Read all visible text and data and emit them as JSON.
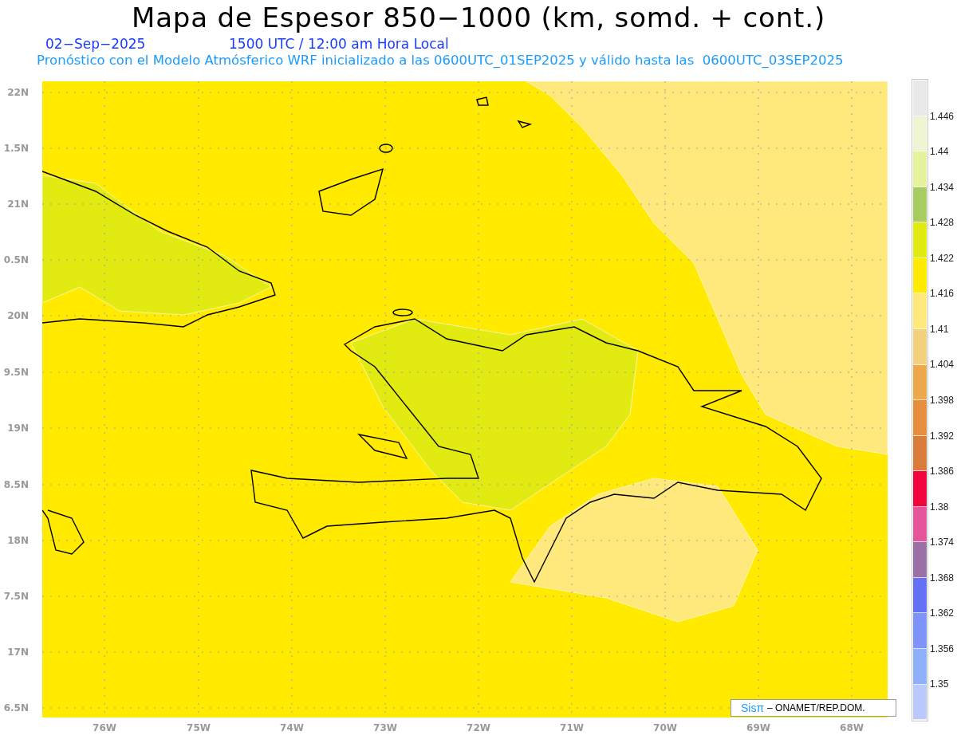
{
  "title": "Mapa de Espesor 850−1000 (km, somd. + cont.)",
  "date": "02−Sep−2025",
  "valid_time": "1500 UTC / 12:00 am Hora Local",
  "subtitle": "Pronóstico con el Modelo Atmósferico WRF inicializado a las 0600UTC_01SEP2025 y válido hasta las  0600UTC_03SEP2025",
  "lat_labels": [
    "22N",
    "1.5N",
    "21N",
    "0.5N",
    "20N",
    "9.5N",
    "19N",
    "8.5N",
    "18N",
    "7.5N",
    "17N",
    "6.5N"
  ],
  "lon_labels": [
    "76W",
    "75W",
    "74W",
    "73W",
    "72W",
    "71W",
    "70W",
    "69W",
    "68W"
  ],
  "legend": {
    "bins": [
      {
        "color": "#e8e8e8"
      },
      {
        "color": "#eef5d2"
      },
      {
        "color": "#e6f39c"
      },
      {
        "color": "#a8cc62"
      },
      {
        "color": "#e1eb12"
      },
      {
        "color": "#ffea00"
      },
      {
        "color": "#ffe97c"
      },
      {
        "color": "#f4d07c"
      },
      {
        "color": "#eca84a"
      },
      {
        "color": "#e78e3e"
      },
      {
        "color": "#d97b3b"
      },
      {
        "color": "#f0063c"
      },
      {
        "color": "#e6559b"
      },
      {
        "color": "#9a70a6"
      },
      {
        "color": "#6470f5"
      },
      {
        "color": "#7f94fb"
      },
      {
        "color": "#8fb1fc"
      },
      {
        "color": "#b9c9fc"
      }
    ],
    "labels": [
      "1.446",
      "1.44",
      "1.434",
      "1.428",
      "1.422",
      "1.416",
      "1.41",
      "1.404",
      "1.398",
      "1.392",
      "1.386",
      "1.38",
      "1.374",
      "1.368",
      "1.362",
      "1.356",
      "1.35"
    ]
  },
  "credit": {
    "logo": "Sisπ",
    "text": "– ONAMET/REP.DOM."
  }
}
